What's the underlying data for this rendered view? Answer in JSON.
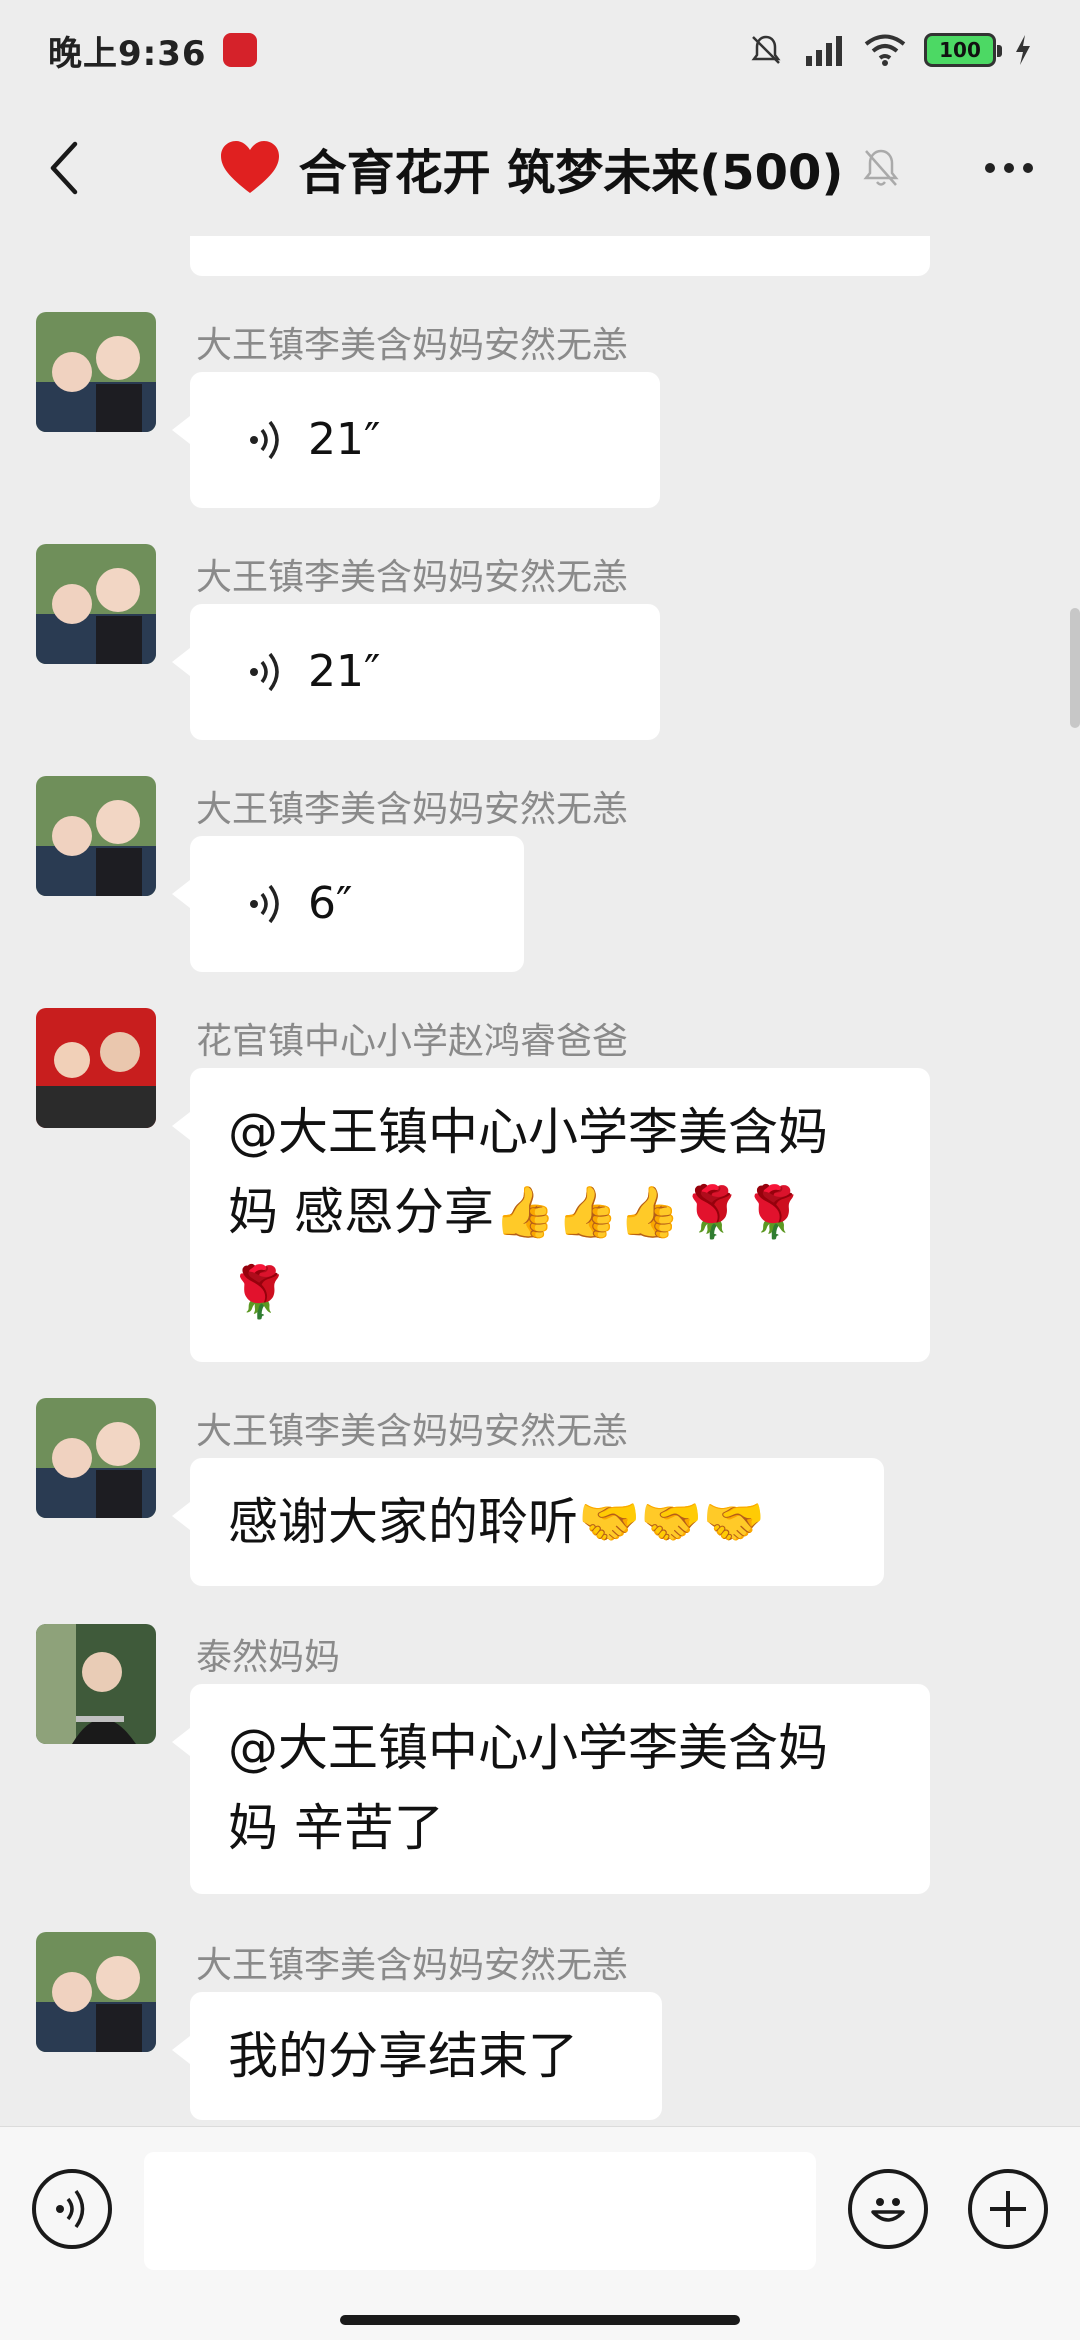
{
  "status_bar": {
    "time": "晚上9:36",
    "battery": "100"
  },
  "header": {
    "title": "合育花开 筑梦未来(500)"
  },
  "messages": [
    {
      "sender": "大王镇李美含妈妈安然无恙",
      "type": "voice",
      "duration": "21″"
    },
    {
      "sender": "大王镇李美含妈妈安然无恙",
      "type": "voice",
      "duration": "21″"
    },
    {
      "sender": "大王镇李美含妈妈安然无恙",
      "type": "voice",
      "duration": "6″"
    },
    {
      "sender": "花官镇中心小学赵鸿睿爸爸",
      "type": "text",
      "line1": "@大王镇中心小学李美含妈",
      "line2": "妈  感恩分享👍👍👍🌹🌹",
      "line3": "🌹"
    },
    {
      "sender": "大王镇李美含妈妈安然无恙",
      "type": "text",
      "line1": "感谢大家的聆听🤝🤝🤝"
    },
    {
      "sender": "泰然妈妈",
      "type": "text",
      "line1": "@大王镇中心小学李美含妈",
      "line2": "妈  辛苦了"
    },
    {
      "sender": "大王镇李美含妈妈安然无恙",
      "type": "text",
      "line1": "我的分享结束了"
    }
  ],
  "input": {
    "value": "",
    "placeholder": ""
  },
  "icons": {
    "back": "back-arrow-icon",
    "group": "heart-icon",
    "mute": "bell-muted-icon",
    "more": "more-dots-icon",
    "voice_toggle": "voice-icon",
    "emoji": "emoji-icon",
    "add": "plus-icon"
  },
  "colors": {
    "background": "#ededed",
    "bubble": "#ffffff",
    "heart": "#e02020",
    "sender_name": "#8a8a8a"
  }
}
